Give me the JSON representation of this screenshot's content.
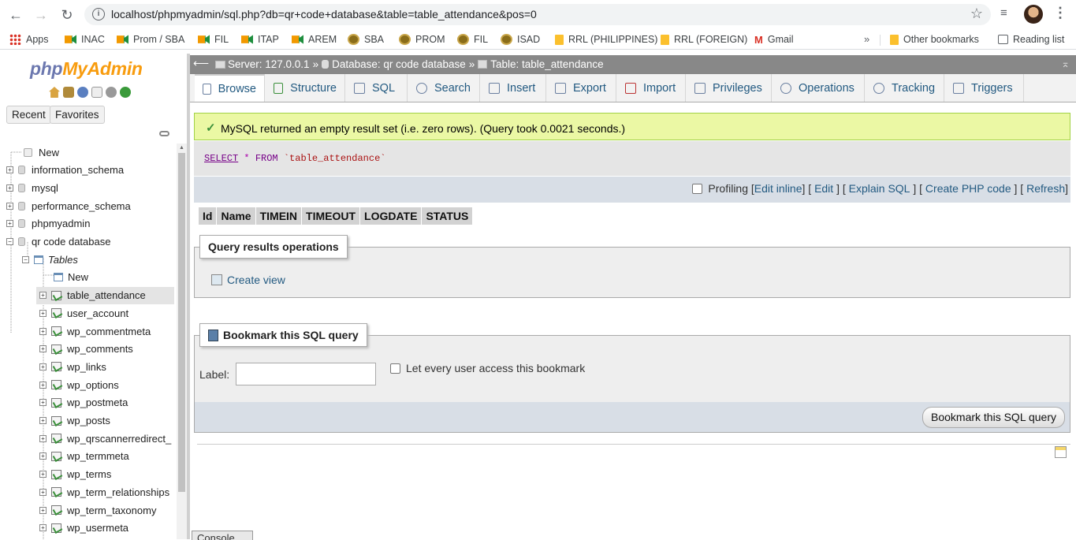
{
  "browser": {
    "url": "localhost/phpmyadmin/sql.php?db=qr+code+database&table=table_attendance&pos=0",
    "icons": {
      "back": "arrow-left-icon",
      "forward": "arrow-right-icon",
      "reload": "reload-icon",
      "info": "info-icon",
      "star": "star-icon",
      "queue": "media-queue-icon",
      "menu": "kebab-menu-icon"
    }
  },
  "bookmarks": {
    "items": [
      {
        "label": "Apps",
        "icon": "apps-grid-icon"
      },
      {
        "label": "INAC",
        "icon": "meet-icon"
      },
      {
        "label": "Prom / SBA",
        "icon": "meet-icon"
      },
      {
        "label": "FIL",
        "icon": "meet-icon"
      },
      {
        "label": "ITAP",
        "icon": "meet-icon"
      },
      {
        "label": "AREM",
        "icon": "meet-icon"
      },
      {
        "label": "SBA",
        "icon": "seal-icon"
      },
      {
        "label": "PROM",
        "icon": "seal-icon"
      },
      {
        "label": "FIL",
        "icon": "seal-icon"
      },
      {
        "label": "ISAD",
        "icon": "seal-icon"
      },
      {
        "label": "RRL (PHILIPPINES)",
        "icon": "folder-icon"
      },
      {
        "label": "RRL (FOREIGN)",
        "icon": "folder-icon"
      },
      {
        "label": "Gmail",
        "icon": "gmail-icon"
      }
    ],
    "more": "»",
    "other": "Other bookmarks",
    "reading_list": "Reading list"
  },
  "nav": {
    "logo_php": "php",
    "logo_my": "My",
    "logo_admin": "Admin",
    "recent": "Recent",
    "favorites": "Favorites",
    "tree": [
      {
        "label": "New",
        "kind": "new"
      },
      {
        "label": "information_schema",
        "kind": "db"
      },
      {
        "label": "mysql",
        "kind": "db"
      },
      {
        "label": "performance_schema",
        "kind": "db"
      },
      {
        "label": "phpmyadmin",
        "kind": "db"
      },
      {
        "label": "qr code database",
        "kind": "db-open"
      },
      {
        "label": "Tables",
        "kind": "group"
      },
      {
        "label": "New",
        "kind": "table-new"
      },
      {
        "label": "table_attendance",
        "kind": "table",
        "active": true
      },
      {
        "label": "user_account",
        "kind": "table"
      },
      {
        "label": "wp_commentmeta",
        "kind": "table"
      },
      {
        "label": "wp_comments",
        "kind": "table"
      },
      {
        "label": "wp_links",
        "kind": "table"
      },
      {
        "label": "wp_options",
        "kind": "table"
      },
      {
        "label": "wp_postmeta",
        "kind": "table"
      },
      {
        "label": "wp_posts",
        "kind": "table"
      },
      {
        "label": "wp_qrscannerredirect_",
        "kind": "table"
      },
      {
        "label": "wp_termmeta",
        "kind": "table"
      },
      {
        "label": "wp_terms",
        "kind": "table"
      },
      {
        "label": "wp_term_relationships",
        "kind": "table"
      },
      {
        "label": "wp_term_taxonomy",
        "kind": "table"
      },
      {
        "label": "wp_usermeta",
        "kind": "table"
      }
    ]
  },
  "breadcrumb": {
    "server": "Server: 127.0.0.1",
    "database": "Database: qr code database",
    "table": "Table: table_attendance",
    "sep": "»"
  },
  "tabs": [
    {
      "label": "Browse",
      "icon": "browse-icon",
      "active": true
    },
    {
      "label": "Structure",
      "icon": "structure-icon"
    },
    {
      "label": "SQL",
      "icon": "sql-icon"
    },
    {
      "label": "Search",
      "icon": "search-icon"
    },
    {
      "label": "Insert",
      "icon": "insert-icon"
    },
    {
      "label": "Export",
      "icon": "export-icon"
    },
    {
      "label": "Import",
      "icon": "import-icon"
    },
    {
      "label": "Privileges",
      "icon": "privileges-icon"
    },
    {
      "label": "Operations",
      "icon": "wrench-icon"
    },
    {
      "label": "Tracking",
      "icon": "eye-icon"
    },
    {
      "label": "Triggers",
      "icon": "triggers-icon"
    }
  ],
  "message": "MySQL returned an empty result set (i.e. zero rows). (Query took 0.0021 seconds.)",
  "query": {
    "select": "SELECT",
    "star": "*",
    "from": "FROM",
    "table": "`table_attendance`"
  },
  "query_links": {
    "profiling": "Profiling",
    "edit_inline": "Edit inline",
    "edit": "Edit",
    "explain": "Explain SQL",
    "php_code": "Create PHP code",
    "refresh": "Refresh"
  },
  "columns": [
    "Id",
    "Name",
    "TIMEIN",
    "TIMEOUT",
    "LOGDATE",
    "STATUS"
  ],
  "qro": {
    "legend": "Query results operations",
    "create_view": "Create view"
  },
  "bookmark": {
    "legend": "Bookmark this SQL query",
    "label": "Label:",
    "input_value": "",
    "every_user": "Let every user access this bookmark",
    "submit": "Bookmark this SQL query"
  },
  "console": "Console",
  "colors": {
    "accent": "#235a81",
    "success_bg": "#ebf8a4",
    "breadcrumb_bg": "#888888"
  }
}
